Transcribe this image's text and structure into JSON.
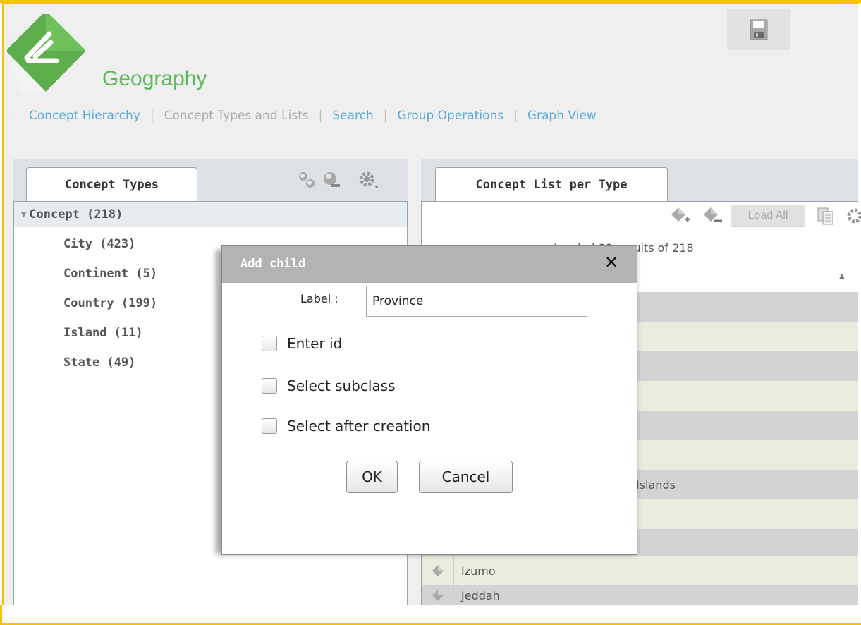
{
  "app": {
    "title": "Geography",
    "accent_color": "#5cb85c",
    "border_color": "#f7c300"
  },
  "nav": {
    "items": [
      "Concept Hierarchy",
      "Concept Types and Lists",
      "Search",
      "Group Operations",
      "Graph View"
    ]
  },
  "left_panel": {
    "tab_label": "Concept Types",
    "tree": {
      "root": "Concept (218)",
      "children": [
        "City (423)",
        "Continent (5)",
        "Country (199)",
        "Island (11)",
        "State (49)"
      ]
    }
  },
  "right_panel": {
    "tab_label": "Concept List per Type",
    "load_all_label": "Load All",
    "results_text": "Loaded 99 results of 218",
    "visible_partial_text": "results of 218",
    "list_items": [
      "",
      "",
      "",
      "",
      "",
      "",
      "Islands",
      "",
      "",
      "Izumo",
      "Jeddah"
    ]
  },
  "dialog": {
    "title": "Add child",
    "close_icon": "close-icon",
    "label_text": "Label :",
    "label_value": "Province",
    "checkboxes": [
      "Enter id",
      "Select subclass",
      "Select after creation"
    ],
    "ok_label": "OK",
    "cancel_label": "Cancel"
  }
}
